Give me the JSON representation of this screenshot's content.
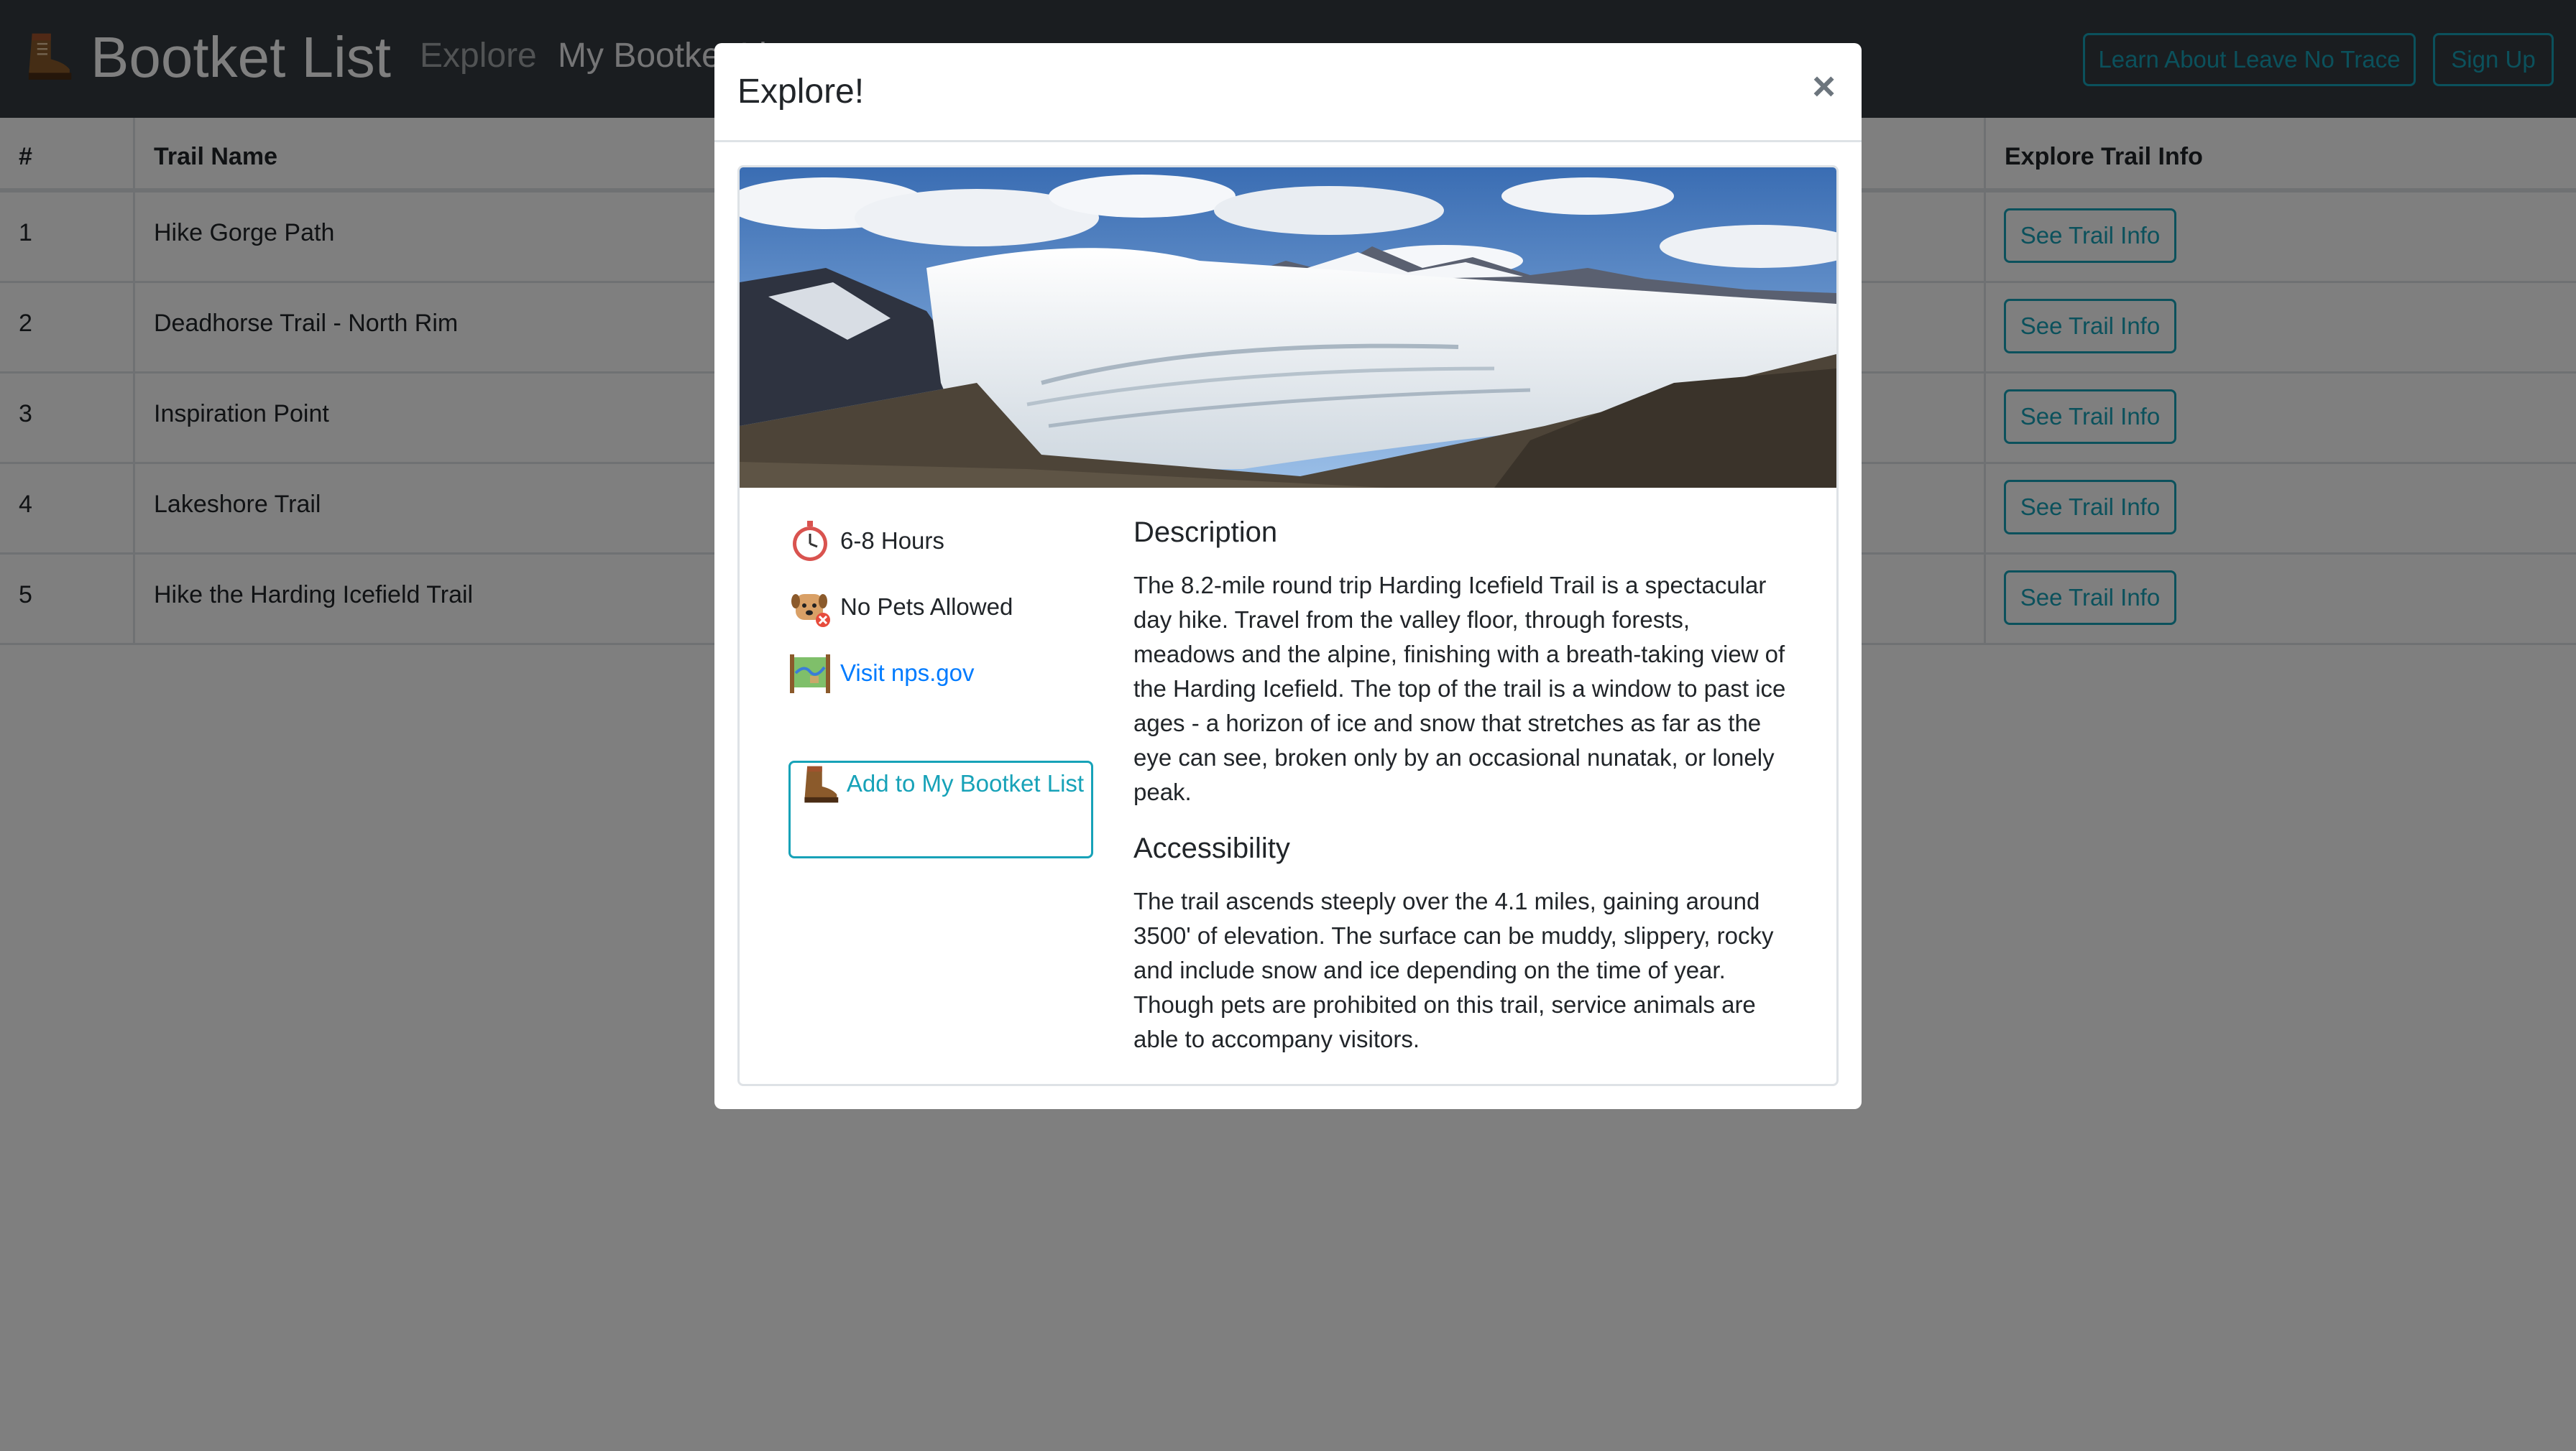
{
  "navbar": {
    "brand": "Bootket List",
    "links": [
      "Explore",
      "My Bootket List"
    ],
    "buttons": {
      "leave_no_trace": "Learn About Leave No Trace",
      "sign_up": "Sign Up"
    }
  },
  "table": {
    "headers": {
      "num": "#",
      "name": "Trail Name",
      "info": "Explore Trail Info"
    },
    "rows": [
      {
        "num": "1",
        "name": "Hike Gorge Path",
        "button": "See Trail Info"
      },
      {
        "num": "2",
        "name": "Deadhorse Trail - North Rim",
        "button": "See Trail Info"
      },
      {
        "num": "3",
        "name": "Inspiration Point",
        "button": "See Trail Info"
      },
      {
        "num": "4",
        "name": "Lakeshore Trail",
        "button": "See Trail Info"
      },
      {
        "num": "5",
        "name": "Hike the Harding Icefield Trail",
        "button": "See Trail Info"
      }
    ]
  },
  "modal": {
    "title": "Explore!",
    "close": "×",
    "duration": "6-8 Hours",
    "pets": "No Pets Allowed",
    "link": "Visit nps.gov",
    "add_button": "Add to My Bootket List",
    "description_title": "Description",
    "description": "The 8.2-mile round trip Harding Icefield Trail is a spectacular day hike. Travel from the valley floor, through forests, meadows and the alpine, finishing with a breath-taking view of the Harding Icefield. The top of the trail is a window to past ice ages - a horizon of ice and snow that stretches as far as the eye can see, broken only by an occasional nunatak, or lonely peak.",
    "accessibility_title": "Accessibility",
    "accessibility": "The trail ascends steeply over the 4.1 miles, gaining around 3500' of elevation. The surface can be muddy, slippery, rocky and include snow and ice depending on the time of year. Though pets are prohibited on this trail, service animals are able to accompany visitors."
  },
  "icons": {
    "brand": "boot-icon",
    "duration": "stopwatch-icon",
    "pets": "dog-no-pets-icon",
    "link": "map-icon",
    "add": "boot-icon"
  },
  "colors": {
    "navbar": "#343a40",
    "info": "#17a2b8",
    "link": "#007bff"
  }
}
